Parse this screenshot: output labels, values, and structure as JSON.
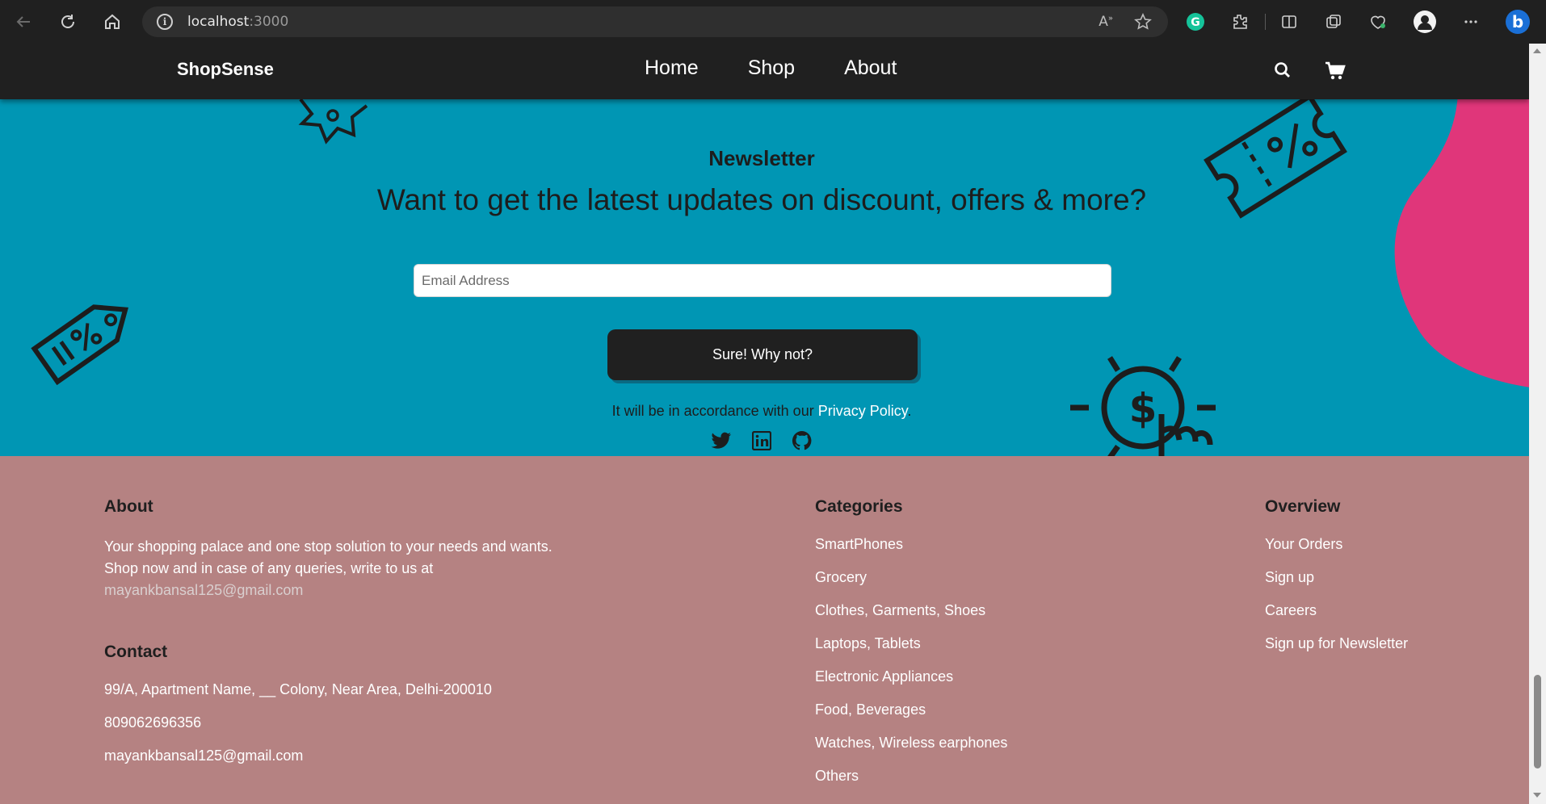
{
  "browser": {
    "url_host": "localhost",
    "url_port": ":3000"
  },
  "header": {
    "brand": "ShopSense",
    "nav": [
      "Home",
      "Shop",
      "About"
    ]
  },
  "newsletter": {
    "title": "Newsletter",
    "subtitle": "Want to get the latest updates on discount, offers & more?",
    "email_placeholder": "Email Address",
    "cta_label": "Sure! Why not?",
    "privacy_prefix": "It will be in accordance with our ",
    "privacy_link": "Privacy Policy",
    "privacy_suffix": ".",
    "accent_blob": "#e0367a",
    "background": "#0096b4"
  },
  "footer": {
    "about": {
      "heading": "About",
      "text": "Your shopping palace and one stop solution to your needs and wants. Shop now and in case of any queries, write to us at",
      "email": " mayankbansal125@gmail.com"
    },
    "contact": {
      "heading": "Contact",
      "address": "99/A, Apartment Name, __ Colony, Near Area, Delhi-200010",
      "phone": "809062696356",
      "email": "mayankbansal125@gmail.com"
    },
    "categories": {
      "heading": "Categories",
      "items": [
        "SmartPhones",
        "Grocery",
        "Clothes, Garments, Shoes",
        "Laptops, Tablets",
        "Electronic Appliances",
        "Food, Beverages",
        "Watches, Wireless earphones",
        "Others"
      ]
    },
    "overview": {
      "heading": "Overview",
      "items": [
        "Your Orders",
        "Sign up",
        "Careers",
        "Sign up for Newsletter"
      ]
    },
    "background": "#b58282"
  }
}
